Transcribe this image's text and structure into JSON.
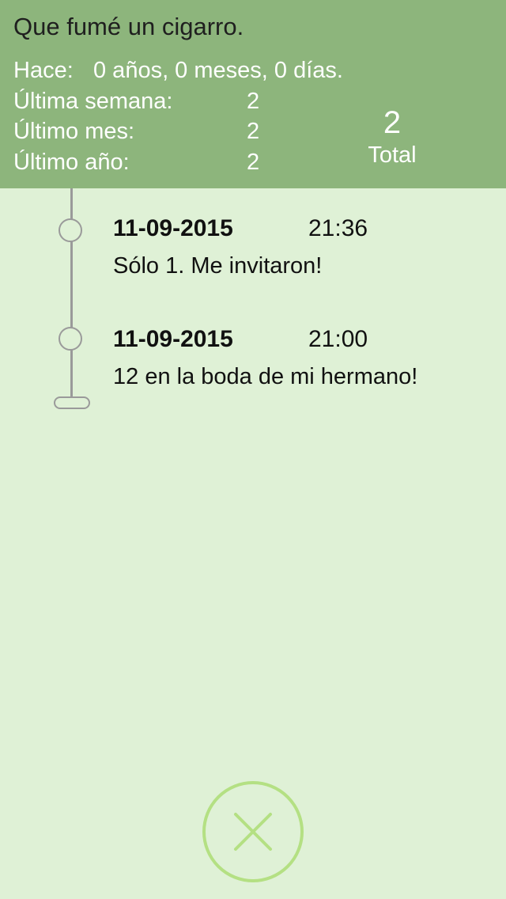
{
  "header": {
    "title": "Que fumé un cigarro.",
    "hace_label": "Hace:",
    "hace_value": "0 años, 0 meses, 0 días.",
    "stats": [
      {
        "label": "Última semana:",
        "value": "2"
      },
      {
        "label": "Último mes:",
        "value": "2"
      },
      {
        "label": "Último año:",
        "value": "2"
      }
    ],
    "total_number": "2",
    "total_label": "Total"
  },
  "entries": [
    {
      "date": "11-09-2015",
      "time": "21:36",
      "note": "Sólo 1. Me invitaron!"
    },
    {
      "date": "11-09-2015",
      "time": "21:00",
      "note": "12 en la boda de mi hermano!"
    }
  ],
  "close_button": {
    "icon": "close-icon"
  },
  "colors": {
    "header_bg": "#8db57c",
    "page_bg": "#dff1d6",
    "accent": "#b4e083",
    "timeline": "#9a9a9a"
  }
}
